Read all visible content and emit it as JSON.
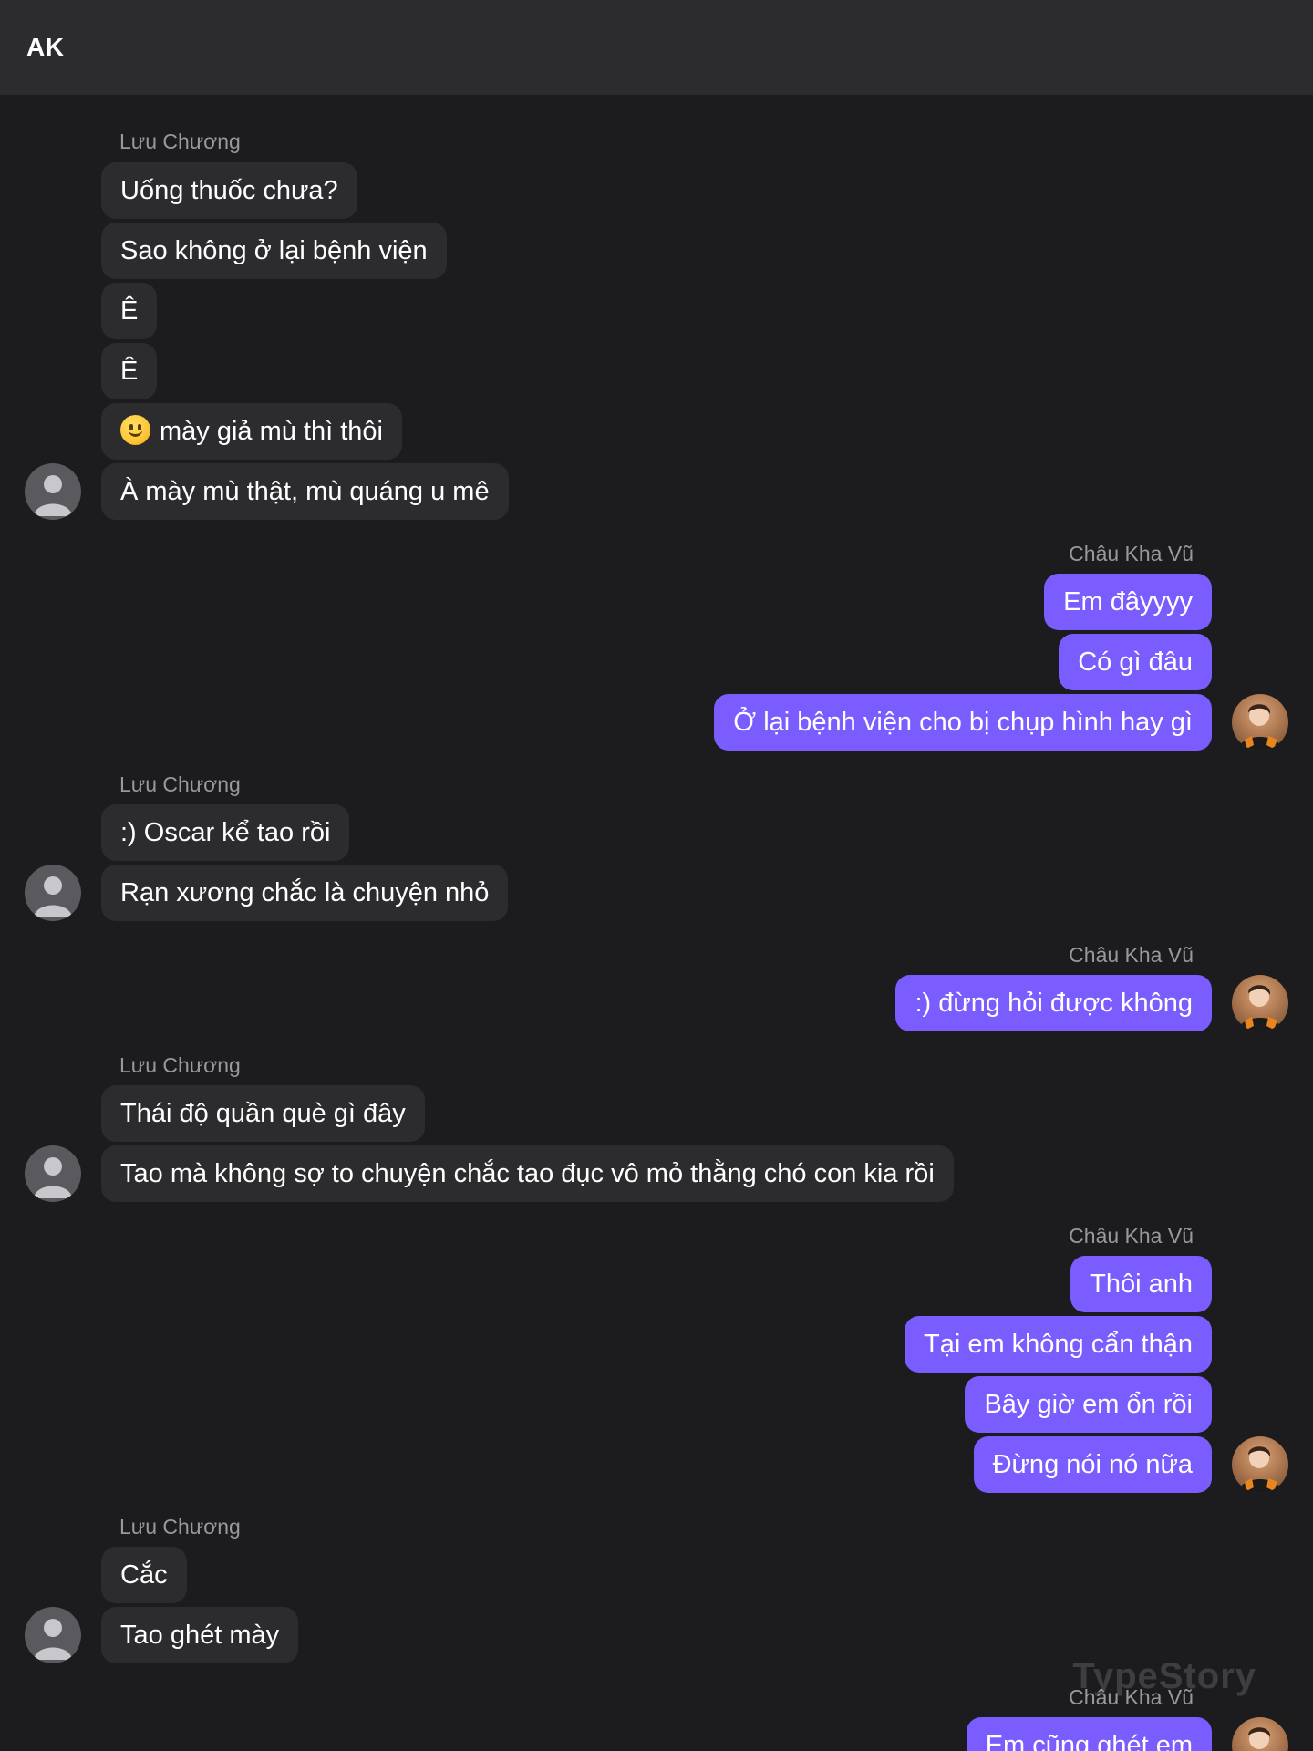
{
  "header": {
    "title": "AK"
  },
  "watermark": "TypeStory",
  "messages": {
    "g1": {
      "sender": "Lưu Chương",
      "m1": "Uống thuốc chưa?",
      "m2": "Sao không ở lại bệnh viện",
      "m3": "Ê",
      "m4": "Ê",
      "m5": "mày giả mù thì thôi",
      "m6": "À mày mù thật, mù quáng u mê"
    },
    "g2": {
      "sender": "Châu Kha Vũ",
      "m1": "Em đâyyyy",
      "m2": "Có gì đâu",
      "m3": "Ở lại bệnh viện cho bị chụp hình hay gì"
    },
    "g3": {
      "sender": "Lưu Chương",
      "m1": ":) Oscar kể tao rồi",
      "m2": "Rạn xương chắc là chuyện nhỏ"
    },
    "g4": {
      "sender": "Châu Kha Vũ",
      "m1": ":) đừng hỏi được không"
    },
    "g5": {
      "sender": "Lưu Chương",
      "m1": "Thái độ quần què gì đây",
      "m2": "Tao mà không sợ to chuyện chắc tao đục vô mỏ thằng chó con kia rồi"
    },
    "g6": {
      "sender": "Châu Kha Vũ",
      "m1": "Thôi anh",
      "m2": "Tại em không cẩn thận",
      "m3": "Bây giờ em ổn rồi",
      "m4": "Đừng nói nó nữa"
    },
    "g7": {
      "sender": "Lưu Chương",
      "m1": "Cắc",
      "m2": "Tao ghét mày"
    },
    "g8": {
      "sender": "Châu Kha Vũ",
      "m1": "Em cũng ghét em"
    }
  },
  "colors": {
    "background": "#1c1c1e",
    "header": "#2c2c2e",
    "incoming_bubble": "#2c2c2e",
    "outgoing_bubble": "#7b5cff",
    "sender_name": "#98989f"
  },
  "icons": {
    "default_avatar": "person-silhouette-icon",
    "emoji": "slightly-smiling-face-emoji"
  }
}
